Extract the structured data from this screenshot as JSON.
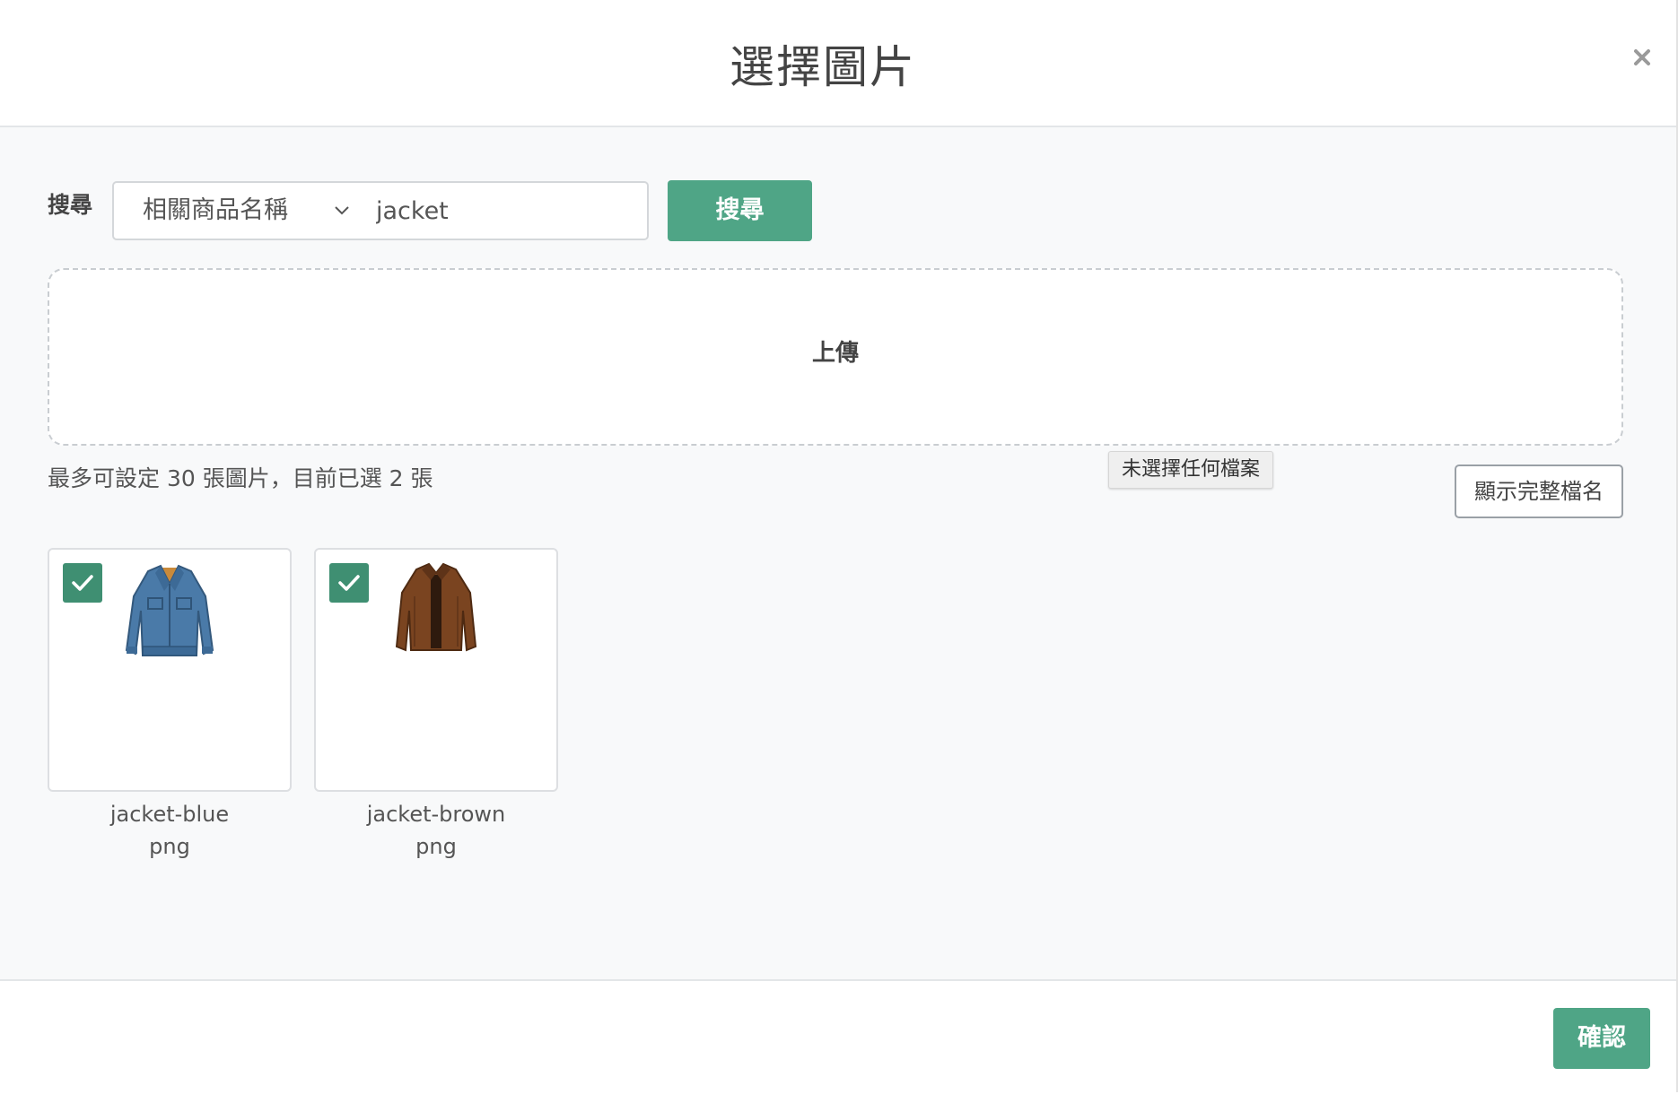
{
  "dialog": {
    "title": "選擇圖片",
    "close_icon": "close-icon"
  },
  "search": {
    "label": "搜尋",
    "field_selected": "相關商品名稱",
    "query_value": "jacket",
    "button_label": "搜尋"
  },
  "upload": {
    "label": "上傳",
    "file_status": "未選擇任何檔案"
  },
  "selection": {
    "summary": "最多可設定 30 張圖片，目前已選 2 張",
    "max": 30,
    "selected": 2,
    "show_full_name_label": "顯示完整檔名"
  },
  "images": [
    {
      "name": "jacket-blue",
      "ext": "png",
      "checked": true,
      "icon": "denim-jacket-image"
    },
    {
      "name": "jacket-brown",
      "ext": "png",
      "checked": true,
      "icon": "leather-jacket-image"
    }
  ],
  "footer": {
    "confirm_label": "確認"
  },
  "colors": {
    "accent": "#4fa586",
    "checkbox": "#3f8f72",
    "body_bg": "#f8f9fa"
  }
}
